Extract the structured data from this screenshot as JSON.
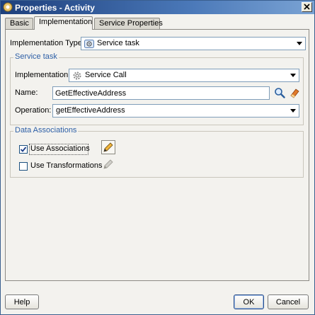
{
  "window": {
    "title": "Properties - Activity"
  },
  "tabs": [
    {
      "label": "Basic"
    },
    {
      "label": "Implementation"
    },
    {
      "label": "Service Properties"
    }
  ],
  "implementation_type": {
    "label": "Implementation Type:",
    "value": "Service task"
  },
  "service_task": {
    "title": "Service task",
    "implementation": {
      "label": "Implementation:",
      "value": "Service Call"
    },
    "name": {
      "label": "Name:",
      "value": "GetEffectiveAddress"
    },
    "operation": {
      "label": "Operation:",
      "value": "getEffectiveAddress"
    }
  },
  "data_associations": {
    "title": "Data Associations",
    "use_associations": {
      "label": "Use Associations",
      "checked": true
    },
    "use_transformations": {
      "label": "Use Transformations",
      "checked": false
    }
  },
  "buttons": {
    "help": "Help",
    "ok": "OK",
    "cancel": "Cancel"
  },
  "colors": {
    "group_title": "#2d5fa6",
    "title_bar": "#1d3f7c",
    "check_mark": "#1c3f8a"
  }
}
